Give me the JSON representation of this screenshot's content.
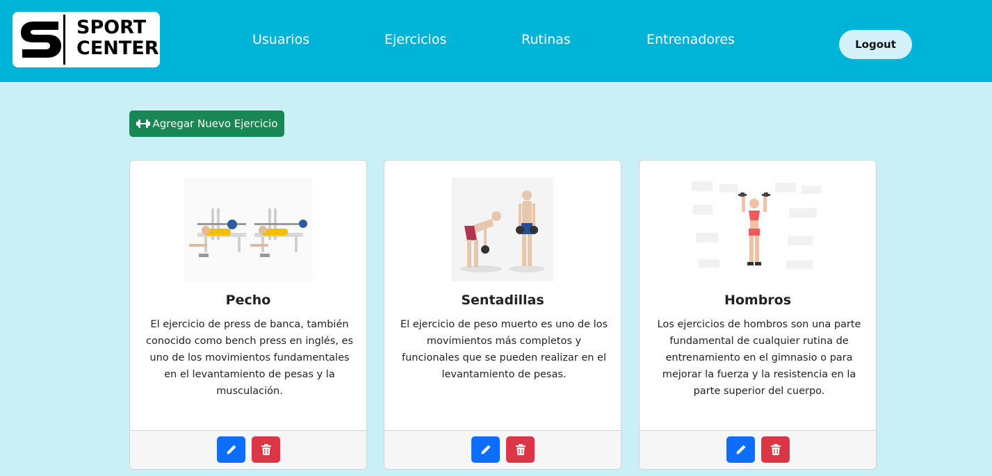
{
  "brand": {
    "line1": "SPORT",
    "line2": "CENTER"
  },
  "nav": {
    "items": [
      {
        "label": "Usuarios"
      },
      {
        "label": "Ejercicios"
      },
      {
        "label": "Rutinas"
      },
      {
        "label": "Entrenadores"
      }
    ],
    "logout_label": "Logout"
  },
  "actions": {
    "add_label": "Agregar Nuevo Ejercicio",
    "add_icon": "dumbbell-icon",
    "edit_icon": "pencil-icon",
    "delete_icon": "trash-icon"
  },
  "colors": {
    "header": "#00b4d8",
    "page_bg": "#c9f0f7",
    "add_button": "#198754",
    "edit_button": "#0d6efd",
    "delete_button": "#dc3545"
  },
  "exercises": [
    {
      "title": "Pecho",
      "image": "bench-press-illustration",
      "description": "El ejercicio de press de banca, también conocido como bench press en inglés, es uno de los movimientos fundamentales en el levantamiento de pesas y la musculación."
    },
    {
      "title": "Sentadillas",
      "image": "deadlift-illustration",
      "description": "El ejercicio de peso muerto es uno de los movimientos más completos y funcionales que se pueden realizar en el levantamiento de pesas."
    },
    {
      "title": "Hombros",
      "image": "shoulder-press-illustration",
      "description": "Los ejercicios de hombros son una parte fundamental de cualquier rutina de entrenamiento en el gimnasio o para mejorar la fuerza y la resistencia en la parte superior del cuerpo."
    }
  ]
}
